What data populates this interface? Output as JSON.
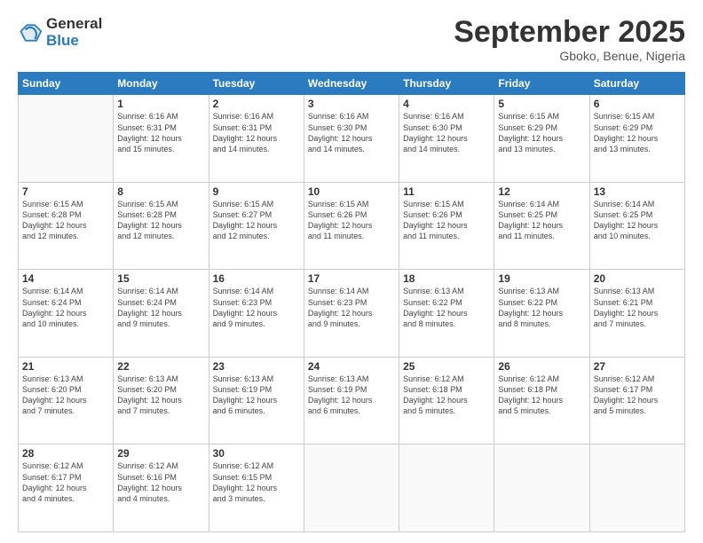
{
  "logo": {
    "general": "General",
    "blue": "Blue"
  },
  "header": {
    "month": "September 2025",
    "location": "Gboko, Benue, Nigeria"
  },
  "weekdays": [
    "Sunday",
    "Monday",
    "Tuesday",
    "Wednesday",
    "Thursday",
    "Friday",
    "Saturday"
  ],
  "weeks": [
    [
      {
        "day": "",
        "info": ""
      },
      {
        "day": "1",
        "info": "Sunrise: 6:16 AM\nSunset: 6:31 PM\nDaylight: 12 hours\nand 15 minutes."
      },
      {
        "day": "2",
        "info": "Sunrise: 6:16 AM\nSunset: 6:31 PM\nDaylight: 12 hours\nand 14 minutes."
      },
      {
        "day": "3",
        "info": "Sunrise: 6:16 AM\nSunset: 6:30 PM\nDaylight: 12 hours\nand 14 minutes."
      },
      {
        "day": "4",
        "info": "Sunrise: 6:16 AM\nSunset: 6:30 PM\nDaylight: 12 hours\nand 14 minutes."
      },
      {
        "day": "5",
        "info": "Sunrise: 6:15 AM\nSunset: 6:29 PM\nDaylight: 12 hours\nand 13 minutes."
      },
      {
        "day": "6",
        "info": "Sunrise: 6:15 AM\nSunset: 6:29 PM\nDaylight: 12 hours\nand 13 minutes."
      }
    ],
    [
      {
        "day": "7",
        "info": "Sunrise: 6:15 AM\nSunset: 6:28 PM\nDaylight: 12 hours\nand 12 minutes."
      },
      {
        "day": "8",
        "info": "Sunrise: 6:15 AM\nSunset: 6:28 PM\nDaylight: 12 hours\nand 12 minutes."
      },
      {
        "day": "9",
        "info": "Sunrise: 6:15 AM\nSunset: 6:27 PM\nDaylight: 12 hours\nand 12 minutes."
      },
      {
        "day": "10",
        "info": "Sunrise: 6:15 AM\nSunset: 6:26 PM\nDaylight: 12 hours\nand 11 minutes."
      },
      {
        "day": "11",
        "info": "Sunrise: 6:15 AM\nSunset: 6:26 PM\nDaylight: 12 hours\nand 11 minutes."
      },
      {
        "day": "12",
        "info": "Sunrise: 6:14 AM\nSunset: 6:25 PM\nDaylight: 12 hours\nand 11 minutes."
      },
      {
        "day": "13",
        "info": "Sunrise: 6:14 AM\nSunset: 6:25 PM\nDaylight: 12 hours\nand 10 minutes."
      }
    ],
    [
      {
        "day": "14",
        "info": "Sunrise: 6:14 AM\nSunset: 6:24 PM\nDaylight: 12 hours\nand 10 minutes."
      },
      {
        "day": "15",
        "info": "Sunrise: 6:14 AM\nSunset: 6:24 PM\nDaylight: 12 hours\nand 9 minutes."
      },
      {
        "day": "16",
        "info": "Sunrise: 6:14 AM\nSunset: 6:23 PM\nDaylight: 12 hours\nand 9 minutes."
      },
      {
        "day": "17",
        "info": "Sunrise: 6:14 AM\nSunset: 6:23 PM\nDaylight: 12 hours\nand 9 minutes."
      },
      {
        "day": "18",
        "info": "Sunrise: 6:13 AM\nSunset: 6:22 PM\nDaylight: 12 hours\nand 8 minutes."
      },
      {
        "day": "19",
        "info": "Sunrise: 6:13 AM\nSunset: 6:22 PM\nDaylight: 12 hours\nand 8 minutes."
      },
      {
        "day": "20",
        "info": "Sunrise: 6:13 AM\nSunset: 6:21 PM\nDaylight: 12 hours\nand 7 minutes."
      }
    ],
    [
      {
        "day": "21",
        "info": "Sunrise: 6:13 AM\nSunset: 6:20 PM\nDaylight: 12 hours\nand 7 minutes."
      },
      {
        "day": "22",
        "info": "Sunrise: 6:13 AM\nSunset: 6:20 PM\nDaylight: 12 hours\nand 7 minutes."
      },
      {
        "day": "23",
        "info": "Sunrise: 6:13 AM\nSunset: 6:19 PM\nDaylight: 12 hours\nand 6 minutes."
      },
      {
        "day": "24",
        "info": "Sunrise: 6:13 AM\nSunset: 6:19 PM\nDaylight: 12 hours\nand 6 minutes."
      },
      {
        "day": "25",
        "info": "Sunrise: 6:12 AM\nSunset: 6:18 PM\nDaylight: 12 hours\nand 5 minutes."
      },
      {
        "day": "26",
        "info": "Sunrise: 6:12 AM\nSunset: 6:18 PM\nDaylight: 12 hours\nand 5 minutes."
      },
      {
        "day": "27",
        "info": "Sunrise: 6:12 AM\nSunset: 6:17 PM\nDaylight: 12 hours\nand 5 minutes."
      }
    ],
    [
      {
        "day": "28",
        "info": "Sunrise: 6:12 AM\nSunset: 6:17 PM\nDaylight: 12 hours\nand 4 minutes."
      },
      {
        "day": "29",
        "info": "Sunrise: 6:12 AM\nSunset: 6:16 PM\nDaylight: 12 hours\nand 4 minutes."
      },
      {
        "day": "30",
        "info": "Sunrise: 6:12 AM\nSunset: 6:15 PM\nDaylight: 12 hours\nand 3 minutes."
      },
      {
        "day": "",
        "info": ""
      },
      {
        "day": "",
        "info": ""
      },
      {
        "day": "",
        "info": ""
      },
      {
        "day": "",
        "info": ""
      }
    ]
  ]
}
